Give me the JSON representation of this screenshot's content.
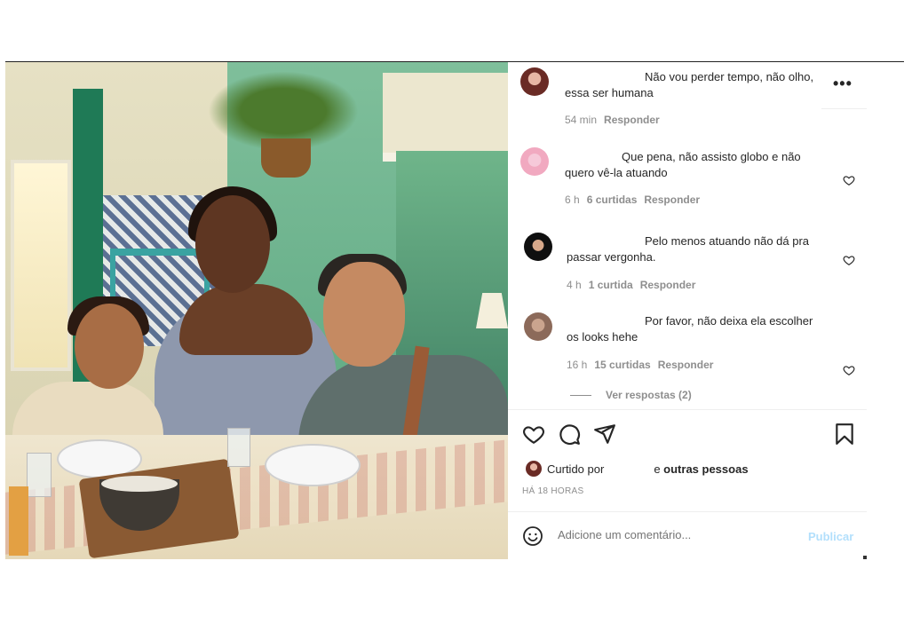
{
  "comments": [
    {
      "text": "Não vou perder tempo, não olho, essa ser humana",
      "time": "54 min",
      "likes": "",
      "reply": "Responder"
    },
    {
      "text": "Que pena, não assisto globo e não quero vê-la atuando",
      "time": "6 h",
      "likes": "6 curtidas",
      "reply": "Responder"
    },
    {
      "text": "Pelo menos atuando não dá pra passar vergonha.",
      "time": "4 h",
      "likes": "1 curtida",
      "reply": "Responder"
    },
    {
      "text": "Por favor, não deixa ela escolher os looks hehe",
      "time": "16 h",
      "likes": "15 curtidas",
      "reply": "Responder"
    }
  ],
  "view_replies": "Ver respostas (2)",
  "likes_summary": {
    "prefix": "Curtido por",
    "suffix_plain": "e",
    "suffix_bold": "outras pessoas"
  },
  "posted_ago": "HÁ 18 HORAS",
  "comment_box": {
    "placeholder": "Adicione um comentário...",
    "publish": "Publicar"
  },
  "icons": {
    "more": "more-options-icon",
    "heart": "heart-icon",
    "comment": "comment-icon",
    "share": "share-icon",
    "save": "bookmark-icon",
    "emoji": "emoji-icon"
  },
  "colors": {
    "text": "#262626",
    "muted": "#8e8e8e",
    "publish_disabled": "#b2dffc"
  }
}
